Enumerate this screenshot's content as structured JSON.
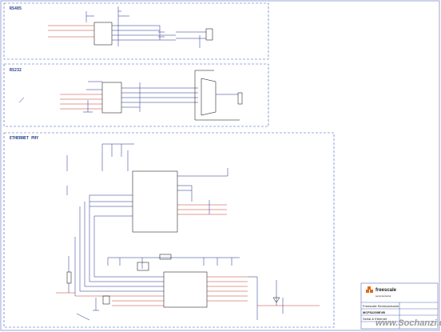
{
  "sections": {
    "rs485": "RS485",
    "rs232": "RS232",
    "ethernet": "ETHERNET PHY"
  },
  "title_block": {
    "logo_text": "freescale",
    "logo_sub": "semiconductor",
    "company_label": "Freescale Semiconductor",
    "board": "MCF52259EVB",
    "sheet_title": "Serial & Ethernet",
    "doc_number": "",
    "date": ""
  },
  "watermark": "www.Sochanzi.com",
  "colors": {
    "wire": "#1f2f8a",
    "net": "#c0392b",
    "frame": "#3a5fbf",
    "ink": "#000000"
  }
}
